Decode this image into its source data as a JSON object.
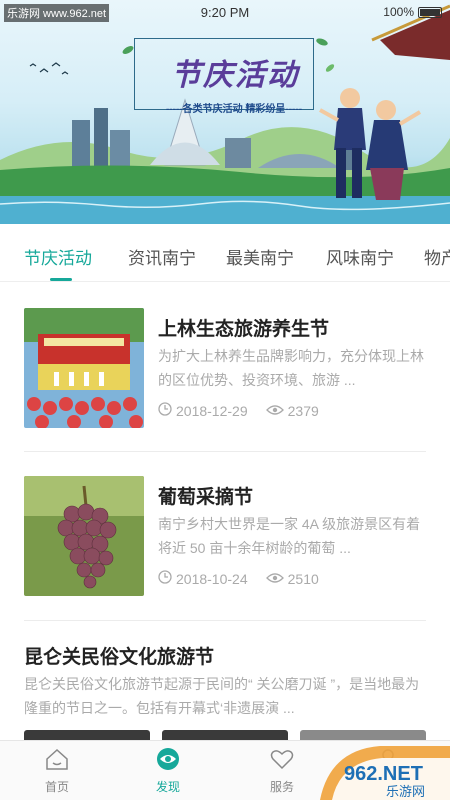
{
  "status_bar": {
    "watermark": "乐游网 www.962.net",
    "time": "9:20 PM",
    "battery": "100%"
  },
  "banner": {
    "title": "节庆活动",
    "subtitle": "-----各类节庆活动  精彩纷呈-----"
  },
  "tabs": [
    "节庆活动",
    "资讯南宁",
    "最美南宁",
    "风味南宁",
    "物产"
  ],
  "active_tab": "节庆活动",
  "articles": [
    {
      "title": "上林生态旅游养生节",
      "description": "为扩大上林养生品牌影响力，充分体现上林的区位优势、投资环境、旅游 ...",
      "date": "2018-12-29",
      "views": "2379"
    },
    {
      "title": "葡萄采摘节",
      "description": "南宁乡村大世界是一家 4A 级旅游景区有着将近 50 亩十余年树龄的葡萄 ...",
      "date": "2018-10-24",
      "views": "2510"
    }
  ],
  "featured": {
    "title": "昆仑关民俗文化旅游节",
    "description": "昆仑关民俗文化旅游节起源于民间的“ 关公磨刀诞 ”，是当地最为隆重的节日之一。包括有开幕式‘非遗展演 ..."
  },
  "bottom_nav": [
    {
      "label": "首页",
      "icon": "home-icon"
    },
    {
      "label": "发现",
      "icon": "eye-icon"
    },
    {
      "label": "服务",
      "icon": "heart-icon"
    },
    {
      "label": "",
      "icon": "user-icon"
    }
  ],
  "active_nav": "发现",
  "corner_watermark": {
    "brand": "962.NET",
    "sub": "乐游网"
  },
  "colors": {
    "accent": "#16a89a",
    "muted": "#aaaaaa",
    "title": "#222222"
  }
}
